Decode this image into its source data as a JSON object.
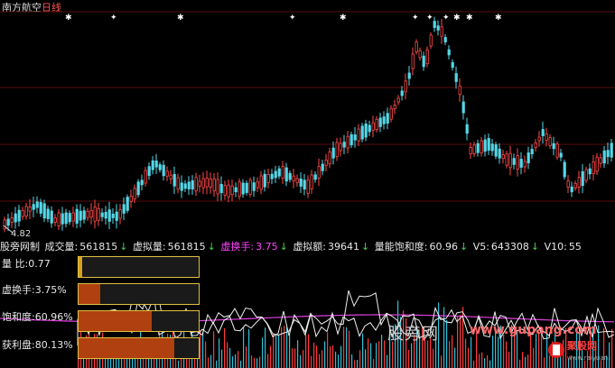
{
  "header": {
    "stock": "南方航空",
    "period": "日线"
  },
  "price_chart": {
    "low_label": "4.82",
    "star_markers": 6,
    "cross_markers": 3
  },
  "info_row": {
    "source": "股旁网制",
    "vol_label": "成交量:",
    "vol_value": "561815",
    "vvol_label": "虚拟量:",
    "vvol_value": "561815",
    "vturn_label": "虚换手:",
    "vturn_value": "3.75",
    "vamt_label": "虚拟额:",
    "vamt_value": "39641",
    "sat_label": "量能饱和度:",
    "sat_value": "60.96",
    "v5_label": "V5:",
    "v5_value": "643308",
    "v10_label": "V10:",
    "v10_value": "55",
    "arrow": "↓"
  },
  "bars": [
    {
      "label": "量  比:0.77",
      "fill": 0.03,
      "color": "#d8a020"
    },
    {
      "label": "虚换手:3.75%",
      "fill": 0.18,
      "color": "#b04010"
    },
    {
      "label": "饱和度:60.96%",
      "fill": 0.61,
      "color": "#b04010"
    },
    {
      "label": "获利盘:80.13%",
      "fill": 0.8,
      "color": "#b04010"
    }
  ],
  "watermark": {
    "cn": "股旁网",
    "url": "www.gupang.com",
    "badge": "聚股网",
    "badge_url": "www.raiyuan.com"
  }
}
